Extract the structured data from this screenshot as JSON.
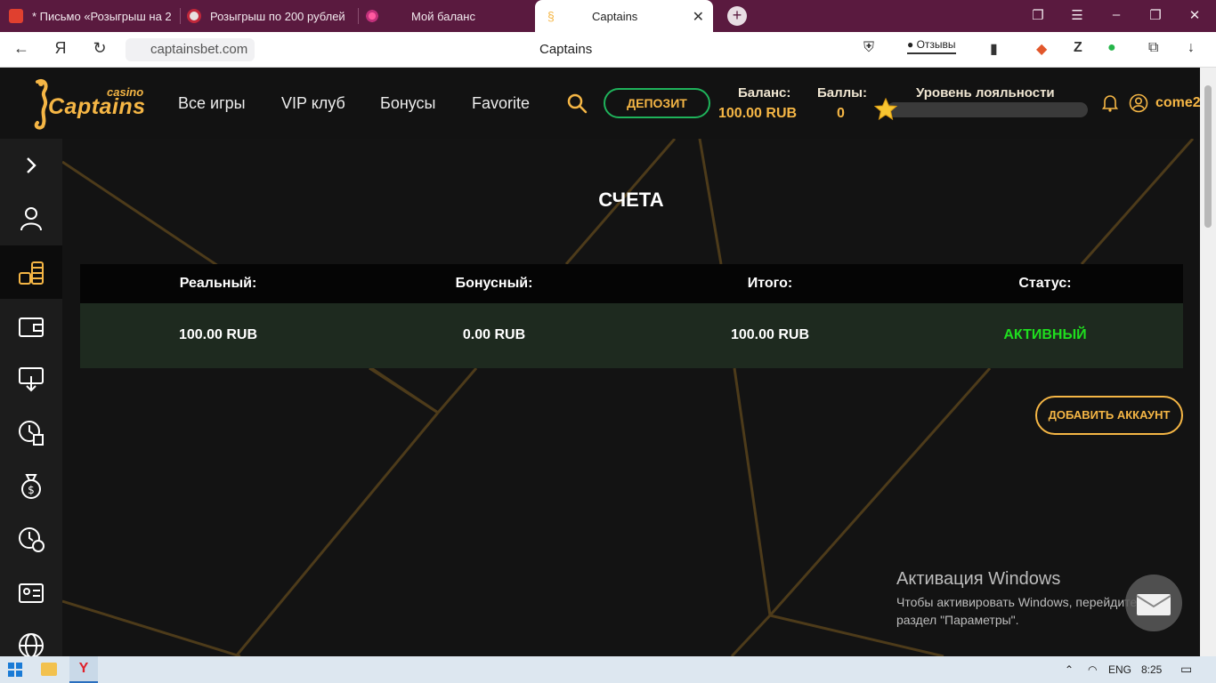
{
  "browser": {
    "tabs": [
      {
        "label": "* Письмо «Розыгрыш на 2",
        "icon": "mail-icon"
      },
      {
        "label": "Розыгрыш по 200 рублей",
        "icon": "chip-icon"
      },
      {
        "label": "Мой баланс",
        "icon": "flower-icon"
      },
      {
        "label": "Captains",
        "icon": "seahorse-icon"
      }
    ],
    "url": "captainsbet.com",
    "page_title": "Captains",
    "reviews_label": "Отзывы"
  },
  "site": {
    "logo_small": "casino",
    "logo_main": "Captains",
    "nav": [
      "Все игры",
      "VIP клуб",
      "Бонусы",
      "Favorite"
    ],
    "deposit_label": "ДЕПОЗИТ",
    "balance_label": "Баланс:",
    "balance_value": "100.00 RUB",
    "points_label": "Баллы:",
    "points_value": "0",
    "loyalty_label": "Уровень лояльности",
    "username": "come2"
  },
  "accounts": {
    "title": "СЧЕТА",
    "headers": [
      "Реальный:",
      "Бонусный:",
      "Итого:",
      "Статус:"
    ],
    "row": [
      "100.00 RUB",
      "0.00 RUB",
      "100.00 RUB",
      "АКТИВНЫЙ"
    ],
    "add_button": "ДОБАВИТЬ АККАУНТ"
  },
  "windows_activation": {
    "title": "Активация Windows",
    "line1": "Чтобы активировать Windows, перейдите в",
    "line2": "раздел \"Параметры\"."
  },
  "taskbar": {
    "lang": "ENG",
    "time": "8:25"
  },
  "colors": {
    "accent": "#f5b645",
    "active_status": "#1fde1f",
    "deposit_border": "#1fb35b",
    "tab_strip": "#5a1a3f"
  }
}
